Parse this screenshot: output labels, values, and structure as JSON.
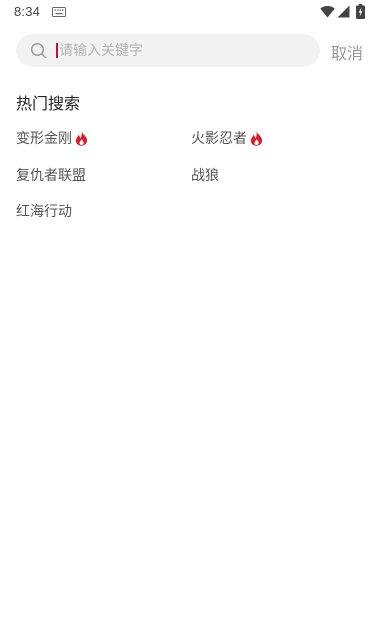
{
  "status_bar": {
    "time": "8:34",
    "icons": [
      "keyboard-icon",
      "wifi-icon",
      "cellular-signal-icon",
      "battery-icon"
    ]
  },
  "search": {
    "placeholder": "请输入关键字",
    "value": "",
    "icon": "search-icon",
    "cancel_label": "取消"
  },
  "hot_search": {
    "title": "热门搜索",
    "items": [
      {
        "label": "变形金刚",
        "hot": true
      },
      {
        "label": "火影忍者",
        "hot": true
      },
      {
        "label": "复仇者联盟",
        "hot": false
      },
      {
        "label": "战狼",
        "hot": false
      },
      {
        "label": "红海行动",
        "hot": false
      }
    ]
  },
  "colors": {
    "accent": "#c8102e",
    "fire": "#d81e2c",
    "search_bg": "#f2f2f2",
    "placeholder": "#b3b3b3",
    "cancel": "#999999"
  }
}
